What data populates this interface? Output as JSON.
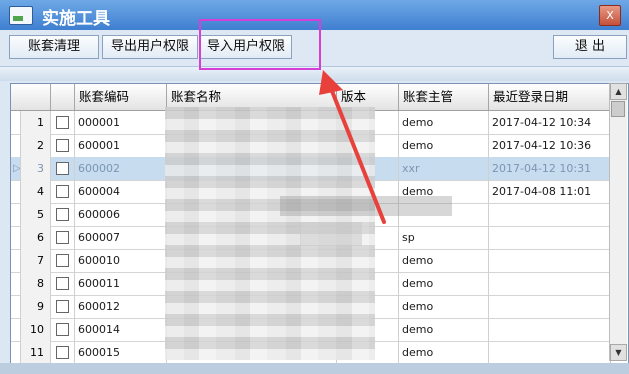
{
  "window": {
    "title": "实施工具",
    "close_label": "X"
  },
  "toolbar": {
    "account_cleanup": "账套清理",
    "export_permissions": "导出用户权限",
    "import_permissions": "导入用户权限",
    "exit": "退 出"
  },
  "grid": {
    "columns": [
      "",
      "",
      "账套编码",
      "账套名称",
      "版本",
      "账套主管",
      "最近登录日期"
    ],
    "rows": [
      {
        "num": "1",
        "code": "000001",
        "manager": "demo",
        "date": "2017-04-12 10:34"
      },
      {
        "num": "2",
        "code": "600001",
        "manager": "demo",
        "date": "2017-04-12 10:36"
      },
      {
        "num": "3",
        "code": "600002",
        "manager": "xxr",
        "date": "2017-04-12 10:31",
        "selected": true
      },
      {
        "num": "4",
        "code": "600004",
        "manager": "demo",
        "date": "2017-04-08 11:01"
      },
      {
        "num": "5",
        "code": "600006",
        "manager": "",
        "date": ""
      },
      {
        "num": "6",
        "code": "600007",
        "manager": "sp",
        "date": ""
      },
      {
        "num": "7",
        "code": "600010",
        "manager": "demo",
        "date": ""
      },
      {
        "num": "8",
        "code": "600011",
        "manager": "demo",
        "date": ""
      },
      {
        "num": "9",
        "code": "600012",
        "manager": "demo",
        "date": ""
      },
      {
        "num": "10",
        "code": "600014",
        "manager": "demo",
        "date": ""
      },
      {
        "num": "11",
        "code": "600015",
        "manager": "demo",
        "date": ""
      }
    ]
  },
  "colors": {
    "highlight_box": "#d63fd6",
    "arrow": "#e8413c",
    "titlebar": "#4f8fd9"
  }
}
